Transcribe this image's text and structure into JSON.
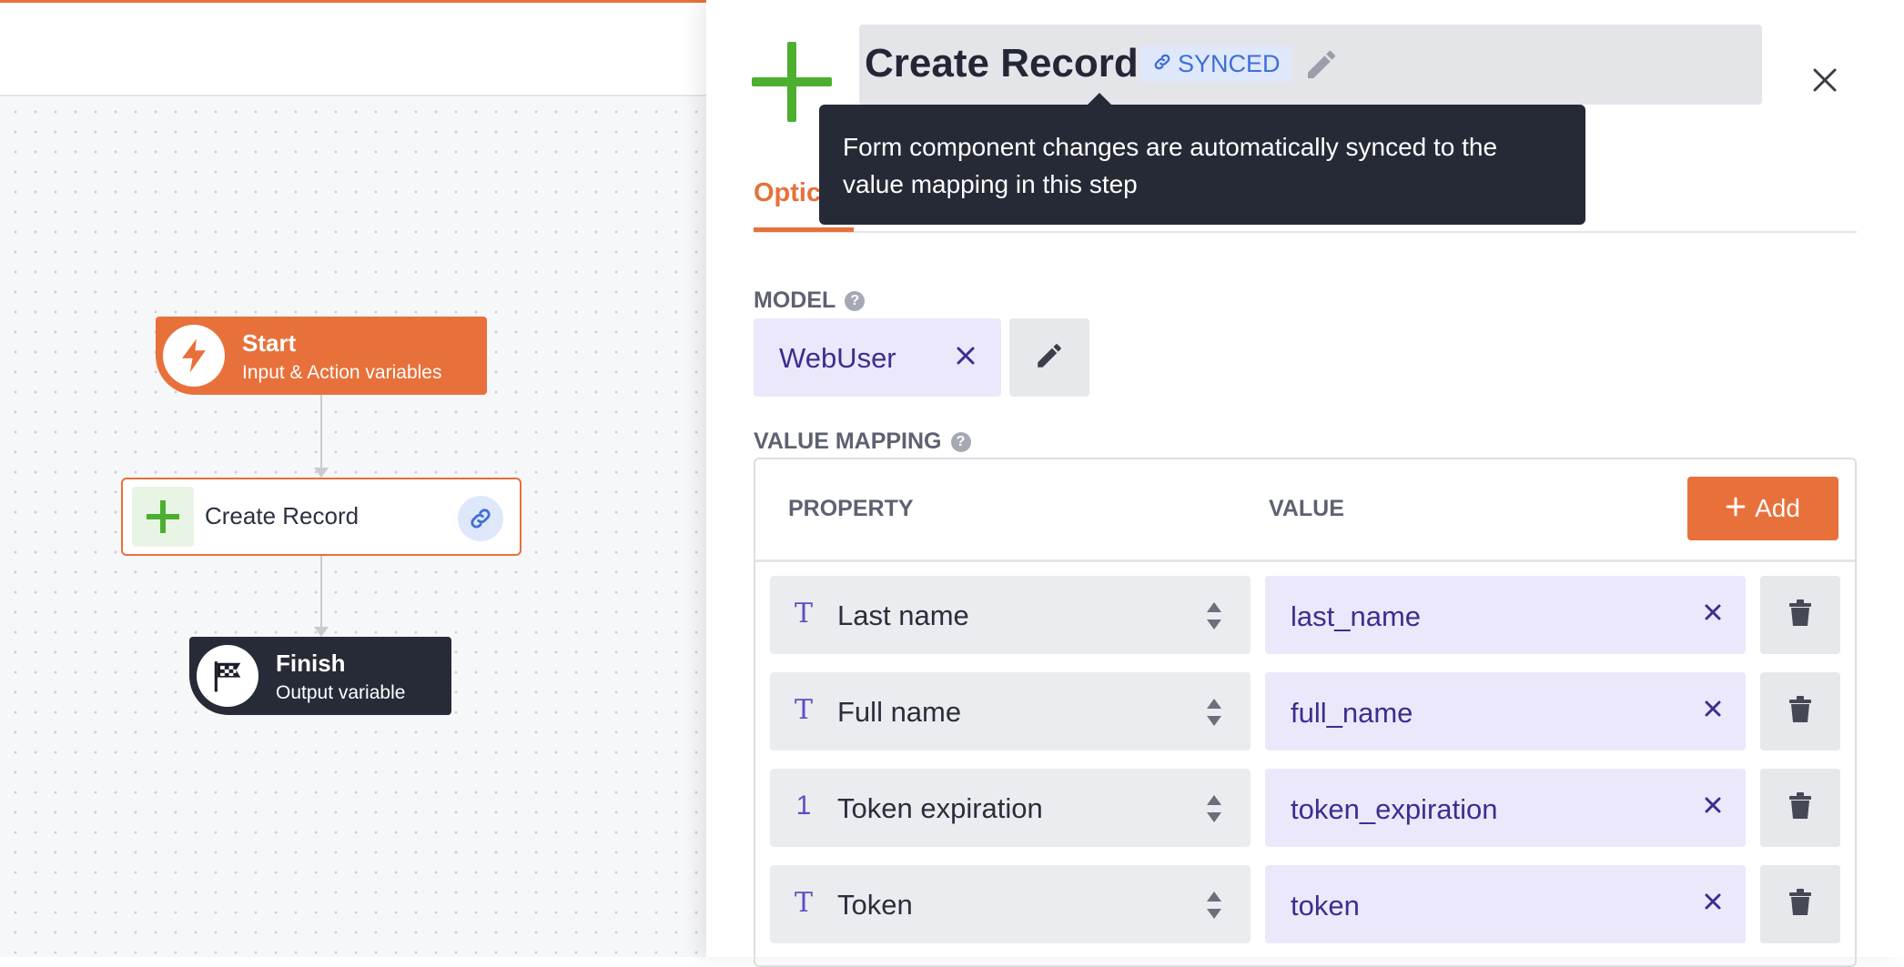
{
  "colors": {
    "accent": "#e8703a",
    "synced_blue": "#3f6fd8",
    "chip_purple": "#ece8fb",
    "chip_text": "#3a2f8f",
    "success_green": "#4caf2f",
    "dark_node": "#272b38"
  },
  "flow": {
    "start": {
      "title": "Start",
      "subtitle": "Input & Action variables",
      "icon": "lightning-icon"
    },
    "create": {
      "label": "Create Record",
      "icon": "plus-icon",
      "link_icon": "link-icon"
    },
    "finish": {
      "title": "Finish",
      "subtitle": "Output variable",
      "icon": "checkered-flag-icon"
    }
  },
  "panel": {
    "title": "Create Record",
    "synced_label": "SYNCED",
    "tooltip": "Form component changes are automatically synced to the value mapping in this step",
    "active_tab": "Optic",
    "model": {
      "label": "MODEL",
      "value": "WebUser"
    },
    "mapping": {
      "label": "VALUE MAPPING",
      "col_property": "PROPERTY",
      "col_value": "VALUE",
      "add_label": "Add",
      "rows": [
        {
          "type": "T",
          "property": "Last name",
          "value": "last_name"
        },
        {
          "type": "T",
          "property": "Full name",
          "value": "full_name"
        },
        {
          "type": "1",
          "property": "Token expiration",
          "value": "token_expiration"
        },
        {
          "type": "T",
          "property": "Token",
          "value": "token"
        }
      ]
    }
  }
}
